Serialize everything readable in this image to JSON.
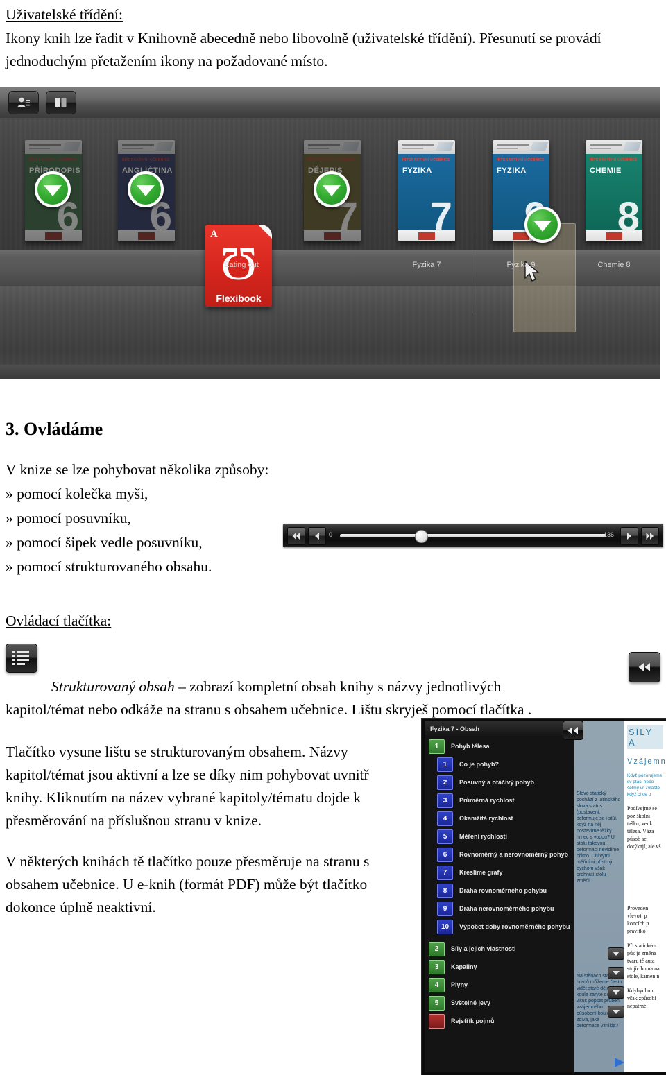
{
  "top": {
    "heading": "Uživatelské třídění:",
    "paragraph": "Ikony knih lze řadit v Knihovně abecedně nebo libovolně (uživatelské třídění). Přesunutí se provádí jednoduchým přetažením ikony na požadované místo.",
    "paragraph_italic_word": "Knihovně"
  },
  "bookshelf": {
    "toolbar": [
      {
        "name": "user-profile-icon",
        "label": "Uživatel"
      },
      {
        "name": "books-view-icon",
        "label": "Knihy"
      }
    ],
    "books": [
      {
        "label": "",
        "title": "PŘÍRODOPIS",
        "kicker": "INTERAKTIVNÍ UČEBNICE",
        "number": "6",
        "color": "#3f7a4a",
        "state": "download",
        "dimmed": true
      },
      {
        "label": "",
        "title": "ANGLIČTINA",
        "kicker": "INTERAKTIVNÍ UČEBNICE",
        "number": "6",
        "color": "#3b4a86",
        "state": "download",
        "dimmed": true
      },
      {
        "label": "Eating out",
        "title": "Flexibook",
        "kicker": "",
        "number": "",
        "color": "#d7261d",
        "state": "pdf",
        "dimmed": false
      },
      {
        "label": "",
        "title": "DĚJEPIS",
        "kicker": "INTERAKTIVNÍ UČEBNICE",
        "number": "7",
        "color": "#7a6a24",
        "state": "download",
        "dimmed": true
      },
      {
        "label": "Fyzika 7",
        "title": "FYZIKA",
        "kicker": "INTERAKTIVNÍ UČEBNICE",
        "number": "7",
        "color": "#1a6aa0",
        "state": "installed",
        "dimmed": false
      },
      {
        "label": "Fyzika 9",
        "title": "FYZIKA",
        "kicker": "INTERAKTIVNÍ UČEBNICE",
        "number": "9",
        "color": "#1a6aa0",
        "state": "dragging",
        "dimmed": false
      },
      {
        "label": "Chemie 8",
        "title": "CHEMIE",
        "kicker": "INTERAKTIVNÍ UČEBNICE",
        "number": "8",
        "color": "#18836f",
        "state": "installed",
        "dimmed": false
      }
    ]
  },
  "section3": {
    "heading": "3. Ovládáme",
    "intro": "V knize se lze pohybovat několika způsoby:",
    "bullets": [
      "» pomocí kolečka myši,",
      "» pomocí posuvníku,",
      "» pomocí šipek vedle posuvníku,",
      "» pomocí strukturovaného obsahu."
    ]
  },
  "nav_slider": {
    "page_start": "0",
    "page_end": "136",
    "buttons": [
      {
        "name": "first-page-button",
        "glyph": "◀◀"
      },
      {
        "name": "prev-page-button",
        "glyph": "◀"
      },
      {
        "name": "next-page-button",
        "glyph": "▶"
      },
      {
        "name": "last-page-button",
        "glyph": "▶▶"
      }
    ]
  },
  "controls_section": {
    "heading": "Ovládací tlačítka:",
    "item_title": "Strukturovaný obsah",
    "item_desc_1": "– zobrazí kompletní obsah knihy s názvy jednotlivých",
    "item_desc_2": "kapitol/témat nebo odkáže na stranu s obsahem učebnice. Lištu skryješ pomocí tlačítka",
    "item_desc_tail": "."
  },
  "bottom_text": {
    "paragraph1": "Tlačítko vysune lištu se strukturovaným obsahem. Názvy kapitol/témat jsou aktivní a lze se díky nim pohybovat uvnitř knihy. Kliknutím na název vybrané kapitoly/tématu dojde k přesměrování na příslušnou stranu v knize.",
    "paragraph2": "V některých knihách tě tlačítko pouze přesměruje na stranu s obsahem učebnice. U e-knih (formát PDF) může být tlačítko dokonce úplně neaktivní."
  },
  "toc_screenshot": {
    "header": "Fyzika 7 - Obsah",
    "collapse_button": "collapse-sidebar-button",
    "entries": [
      {
        "num": "1",
        "label": "Pohyb tělesa",
        "level": 1,
        "color": "green"
      },
      {
        "num": "1",
        "label": "Co je pohyb?",
        "level": 2,
        "color": "blue"
      },
      {
        "num": "2",
        "label": "Posuvný a otáčivý pohyb",
        "level": 2,
        "color": "blue"
      },
      {
        "num": "3",
        "label": "Průměrná rychlost",
        "level": 2,
        "color": "blue"
      },
      {
        "num": "4",
        "label": "Okamžitá rychlost",
        "level": 2,
        "color": "blue"
      },
      {
        "num": "5",
        "label": "Měření rychlosti",
        "level": 2,
        "color": "blue"
      },
      {
        "num": "6",
        "label": "Rovnoměrný a nerovnoměrný pohyb",
        "level": 2,
        "color": "blue"
      },
      {
        "num": "7",
        "label": "Kreslíme grafy",
        "level": 2,
        "color": "blue"
      },
      {
        "num": "8",
        "label": "Dráha rovnoměrného pohybu",
        "level": 2,
        "color": "blue"
      },
      {
        "num": "9",
        "label": "Dráha nerovnoměrného pohybu",
        "level": 2,
        "color": "blue"
      },
      {
        "num": "10",
        "label": "Výpočet doby rovnoměrného pohybu",
        "level": 2,
        "color": "blue"
      },
      {
        "num": "2",
        "label": "Síly a jejich vlastnosti",
        "level": 1,
        "color": "green",
        "caret": true
      },
      {
        "num": "3",
        "label": "Kapaliny",
        "level": 1,
        "color": "green",
        "caret": true
      },
      {
        "num": "4",
        "label": "Plyny",
        "level": 1,
        "color": "green",
        "caret": true
      },
      {
        "num": "5",
        "label": "Světelné jevy",
        "level": 1,
        "color": "green",
        "caret": true
      },
      {
        "num": "",
        "label": "Rejstřík pojmů",
        "level": 1,
        "color": "red"
      }
    ],
    "page_middle_text": "Slovo statický pochází z latinského slova status (postavení, deformuje se i stůl, když na něj postavíme těžký hrnec s vodou? U stolu takovou deformaci nevidíme přímo. Citlivými měřicími přístroji bychom však prohnutí stolu změřili.",
    "page_middle_text2": "Na stěnách starých hradů můžeme často vidět staré dělové koule zaryté do zdi. Zkus popsat průběh vzájemného působení koule a zdiva, jaká deformace vznikla?",
    "page_right": {
      "title1": "SÍLY A",
      "title2": "Vzájemn",
      "teal": "Když pozorujeme sv ptáci nebo šelmy vr Zvláště když chce p",
      "serif1": "Podívejme se poz školní tašku, venk tělesa. Váza působ se dotýkají, ale vš",
      "serif2": "Proveden vlevo), p koncích p pravítko",
      "serif3": "Při statickém půs je změna tvaru tě auta stojícího na na stole, kámen n",
      "serif4": "Kdybychom však způsobí nepatrné"
    }
  },
  "colors": {
    "accent_green": "#2e7a2c",
    "accent_blue": "#1b2796",
    "accent_red": "#b53030",
    "pdf_red": "#d7261d"
  }
}
